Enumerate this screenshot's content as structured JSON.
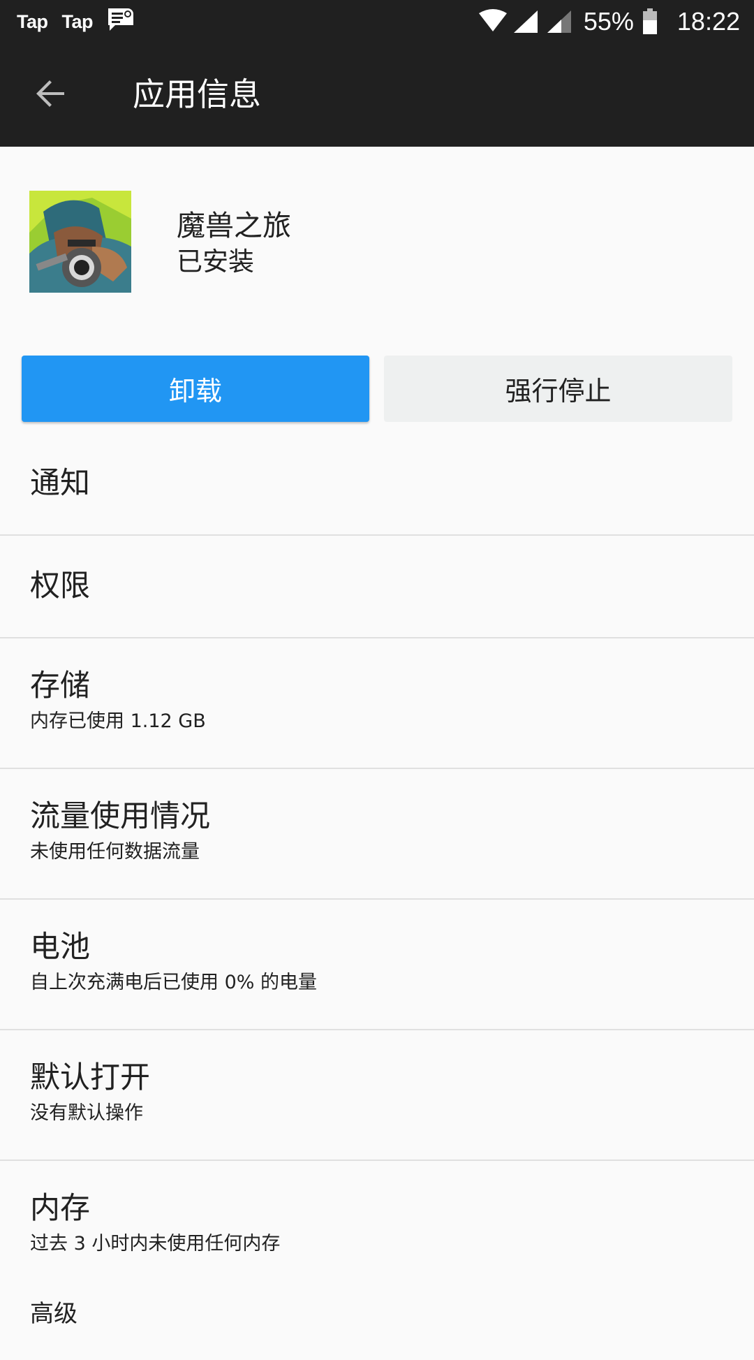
{
  "status_bar": {
    "left_apps": [
      "Tap",
      "Tap"
    ],
    "battery_percent": "55%",
    "time": "18:22",
    "icons": [
      "message-icon",
      "wifi-icon",
      "signal-icon",
      "signal-icon-2",
      "battery-icon"
    ]
  },
  "app_bar": {
    "title": "应用信息",
    "back_icon": "arrow-left-icon"
  },
  "app": {
    "name": "魔兽之旅",
    "status": "已安装"
  },
  "buttons": {
    "uninstall": "卸载",
    "force_stop": "强行停止"
  },
  "settings": {
    "notifications": {
      "title": "通知"
    },
    "permissions": {
      "title": "权限"
    },
    "storage": {
      "title": "存储",
      "summary": "内存已使用 1.12 GB"
    },
    "data_usage": {
      "title": "流量使用情况",
      "summary": "未使用任何数据流量"
    },
    "battery": {
      "title": "电池",
      "summary": "自上次充满电后已使用 0% 的电量"
    },
    "open_by_default": {
      "title": "默认打开",
      "summary": "没有默认操作"
    },
    "memory": {
      "title": "内存",
      "summary": "过去 3 小时内未使用任何内存"
    },
    "advanced": {
      "title": "高级"
    }
  },
  "colors": {
    "status_bar_bg": "#202020",
    "app_bar_bg": "#202020",
    "accent": "#2196f3",
    "page_bg": "#fafafa"
  }
}
